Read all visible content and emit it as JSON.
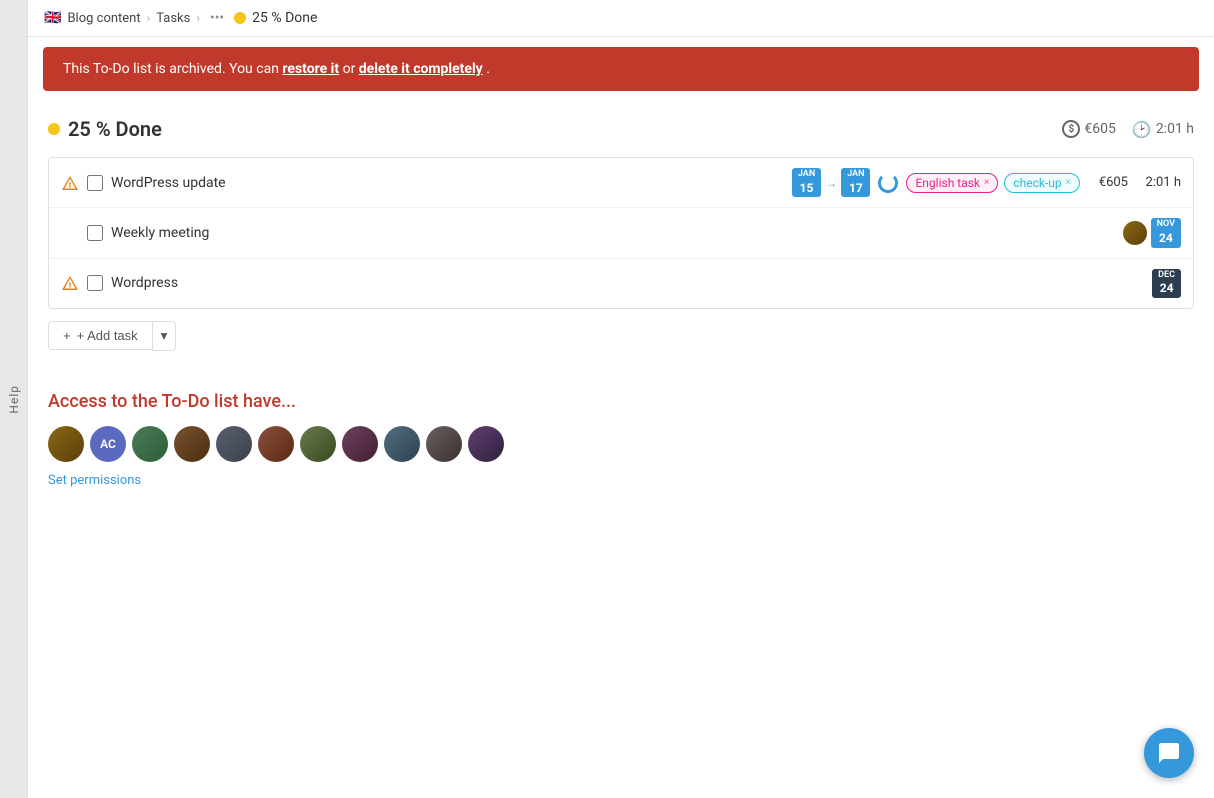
{
  "breadcrumb": {
    "flag": "🇬🇧",
    "project": "Blog content",
    "tasks_label": "Tasks",
    "current_label": "25 % Done"
  },
  "archive_banner": {
    "text_prefix": "This To-Do list is archived. You can ",
    "restore_label": "restore it",
    "text_middle": " or ",
    "delete_label": "delete it completely",
    "text_suffix": "."
  },
  "todo": {
    "title": "25 % Done",
    "total_cost": "€605",
    "total_time": "2:01 h"
  },
  "tasks": [
    {
      "id": 1,
      "name": "WordPress update",
      "has_warning": true,
      "date_start_month": "Jan",
      "date_start_day": "15",
      "date_end_month": "Jan",
      "date_end_day": "17",
      "has_progress": true,
      "tags": [
        "English task",
        "check-up"
      ],
      "cost": "€605",
      "time": "2:01 h"
    },
    {
      "id": 2,
      "name": "Weekly meeting",
      "has_warning": false,
      "date_month": "Nov",
      "date_day": "24",
      "has_progress": false,
      "tags": [],
      "cost": "",
      "time": ""
    },
    {
      "id": 3,
      "name": "Wordpress",
      "has_warning": true,
      "date_month": "Dec",
      "date_day": "24",
      "has_progress": false,
      "tags": [],
      "cost": "",
      "time": ""
    }
  ],
  "add_task": {
    "label": "+ Add task"
  },
  "access": {
    "title": "Access to the To-Do list have...",
    "avatars": [
      {
        "id": 1,
        "type": "img",
        "class": "avatar-img-1",
        "initials": ""
      },
      {
        "id": 2,
        "type": "initials",
        "class": "avatar-initials",
        "initials": "AC"
      },
      {
        "id": 3,
        "type": "img",
        "class": "avatar-img-2",
        "initials": ""
      },
      {
        "id": 4,
        "type": "img",
        "class": "avatar-img-3",
        "initials": ""
      },
      {
        "id": 5,
        "type": "img",
        "class": "avatar-img-4",
        "initials": ""
      },
      {
        "id": 6,
        "type": "img",
        "class": "avatar-img-5",
        "initials": ""
      },
      {
        "id": 7,
        "type": "img",
        "class": "avatar-img-6",
        "initials": ""
      },
      {
        "id": 8,
        "type": "img",
        "class": "avatar-img-7",
        "initials": ""
      },
      {
        "id": 9,
        "type": "img",
        "class": "avatar-img-8",
        "initials": ""
      },
      {
        "id": 10,
        "type": "img",
        "class": "avatar-img-9",
        "initials": ""
      },
      {
        "id": 11,
        "type": "img",
        "class": "avatar-img-10",
        "initials": ""
      }
    ],
    "set_permissions_label": "Set permissions"
  },
  "help_label": "Help",
  "icons": {
    "dollar": "💲",
    "clock": "🕑",
    "plus": "+",
    "chevron_down": "▾",
    "warning": "⚠"
  }
}
